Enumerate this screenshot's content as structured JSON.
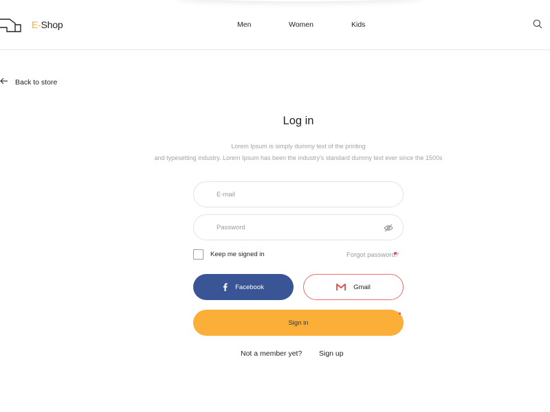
{
  "brand": {
    "prefix": "E-",
    "name": "Shop",
    "accent_color": "#f7ac36"
  },
  "nav": {
    "items": [
      {
        "label": "Men"
      },
      {
        "label": "Women"
      },
      {
        "label": "Kids"
      }
    ],
    "search_icon": "search-icon"
  },
  "back": {
    "label": "Back to store",
    "icon": "arrow-left-icon"
  },
  "login": {
    "title": "Log in",
    "description_line1": "Lorem Ipsum is simply dummy text of the printing",
    "description_line2": "and typesetting industry. Lorem Ipsum has been the industry's standard dummy text ever since the 1500s",
    "email_placeholder": "E-mail",
    "email_value": "",
    "password_placeholder": "Password",
    "password_value": "",
    "remember_label": "Keep me signed in",
    "remember_checked": false,
    "forgot_label": "Forgot password?",
    "facebook_label": "Facebook",
    "gmail_label": "Gmail",
    "signin_label": "Sign in",
    "not_member_text": "Not a member yet?",
    "signup_label": "Sign up"
  },
  "colors": {
    "facebook": "#3a5595",
    "gmail_border": "#ef6a6a",
    "signin": "#fbae38"
  }
}
